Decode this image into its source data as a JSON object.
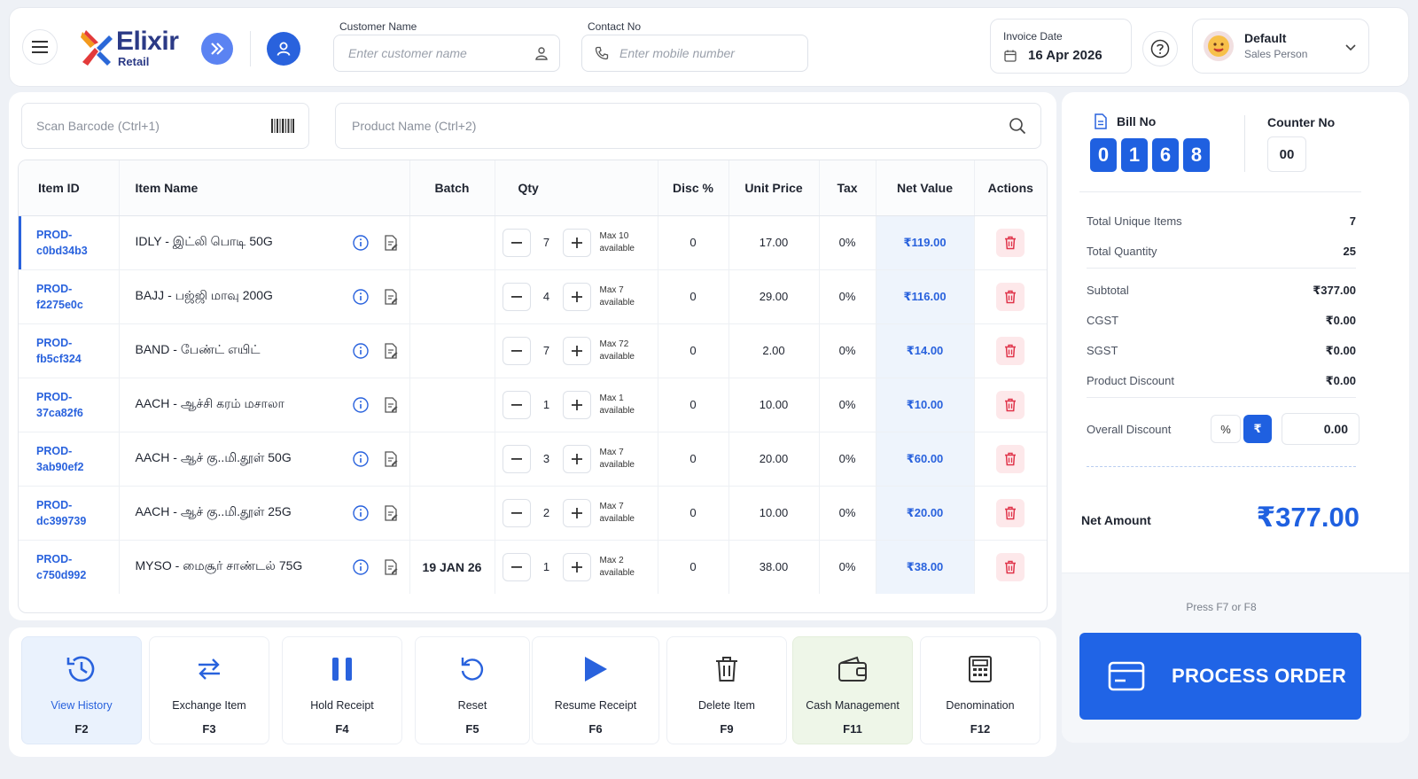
{
  "header": {
    "logo_name": "Elixir",
    "logo_sub": "Retail",
    "customer_label": "Customer Name",
    "customer_placeholder": "Enter customer name",
    "contact_label": "Contact No",
    "contact_placeholder": "Enter mobile number",
    "invoice_date_label": "Invoice Date",
    "invoice_date": "16 Apr 2026",
    "salesperson_name": "Default",
    "salesperson_role": "Sales Person"
  },
  "search": {
    "barcode_placeholder": "Scan Barcode (Ctrl+1)",
    "product_placeholder": "Product Name (Ctrl+2)"
  },
  "table": {
    "headers": [
      "Item ID",
      "Item Name",
      "Batch",
      "Qty",
      "Disc %",
      "Unit Price",
      "Tax",
      "Net Value",
      "Actions"
    ],
    "rows": [
      {
        "id1": "PROD-",
        "id2": "c0bd34b3",
        "name": "IDLY - இட்லி பொடி 50G",
        "batch": "",
        "qty": "7",
        "max1": "Max 10",
        "max2": "available",
        "disc": "0",
        "price": "17.00",
        "tax": "0%",
        "net": "₹119.00"
      },
      {
        "id1": "PROD-",
        "id2": "f2275e0c",
        "name": "BAJJ - பஜ்ஜி மாவு 200G",
        "batch": "",
        "qty": "4",
        "max1": "Max 7",
        "max2": "available",
        "disc": "0",
        "price": "29.00",
        "tax": "0%",
        "net": "₹116.00"
      },
      {
        "id1": "PROD-",
        "id2": "fb5cf324",
        "name": "BAND - பேண்ட் எயிட்",
        "batch": "",
        "qty": "7",
        "max1": "Max 72",
        "max2": "available",
        "disc": "0",
        "price": "2.00",
        "tax": "0%",
        "net": "₹14.00"
      },
      {
        "id1": "PROD-",
        "id2": "37ca82f6",
        "name": "AACH - ஆச்சி கரம் மசாலா",
        "batch": "",
        "qty": "1",
        "max1": "Max 1",
        "max2": "available",
        "disc": "0",
        "price": "10.00",
        "tax": "0%",
        "net": "₹10.00"
      },
      {
        "id1": "PROD-",
        "id2": "3ab90ef2",
        "name": "AACH - ஆச் கு..மி.தூள் 50G",
        "batch": "",
        "qty": "3",
        "max1": "Max 7",
        "max2": "available",
        "disc": "0",
        "price": "20.00",
        "tax": "0%",
        "net": "₹60.00"
      },
      {
        "id1": "PROD-",
        "id2": "dc399739",
        "name": "AACH - ஆச் கு..மி.தூள் 25G",
        "batch": "",
        "qty": "2",
        "max1": "Max 7",
        "max2": "available",
        "disc": "0",
        "price": "10.00",
        "tax": "0%",
        "net": "₹20.00"
      },
      {
        "id1": "PROD-",
        "id2": "c750d992",
        "name": "MYSO - மைசூர் சாண்டல் 75G",
        "batch": "19 JAN 26",
        "qty": "1",
        "max1": "Max 2",
        "max2": "available",
        "disc": "0",
        "price": "38.00",
        "tax": "0%",
        "net": "₹38.00"
      }
    ]
  },
  "actions": [
    {
      "label": "View History",
      "key": "F2",
      "icon": "history-icon"
    },
    {
      "label": "Exchange Item",
      "key": "F3",
      "icon": "exchange-icon"
    },
    {
      "label": "Hold Receipt",
      "key": "F4",
      "icon": "pause-icon"
    },
    {
      "label": "Reset",
      "key": "F5",
      "icon": "reset-icon"
    },
    {
      "label": "Resume Receipt",
      "key": "F6",
      "icon": "play-icon"
    },
    {
      "label": "Delete Item",
      "key": "F9",
      "icon": "trash-icon"
    },
    {
      "label": "Cash Management",
      "key": "F11",
      "icon": "wallet-icon"
    },
    {
      "label": "Denomination",
      "key": "F12",
      "icon": "calculator-icon"
    }
  ],
  "summary": {
    "bill_no_label": "Bill No",
    "bill_digits": [
      "0",
      "1",
      "6",
      "8"
    ],
    "counter_label": "Counter No",
    "counter_no": "00",
    "total_unique_label": "Total Unique Items",
    "total_unique": "7",
    "total_qty_label": "Total Quantity",
    "total_qty": "25",
    "subtotal_label": "Subtotal",
    "subtotal": "₹377.00",
    "cgst_label": "CGST",
    "cgst": "₹0.00",
    "sgst_label": "SGST",
    "sgst": "₹0.00",
    "product_discount_label": "Product Discount",
    "product_discount": "₹0.00",
    "overall_discount_label": "Overall Discount",
    "percent_label": "%",
    "rupee_label": "₹",
    "overall_discount": "0.00",
    "net_amount_label": "Net Amount",
    "net_amount": "₹377.00",
    "hint": "Press F7 or F8",
    "process_label": "PROCESS ORDER"
  },
  "colors": {
    "primary": "#2064e6",
    "accent_blue": "#2962dd",
    "danger": "#e0344a",
    "history_bg": "#eaf2fd",
    "cash_bg": "#eef6e8"
  }
}
